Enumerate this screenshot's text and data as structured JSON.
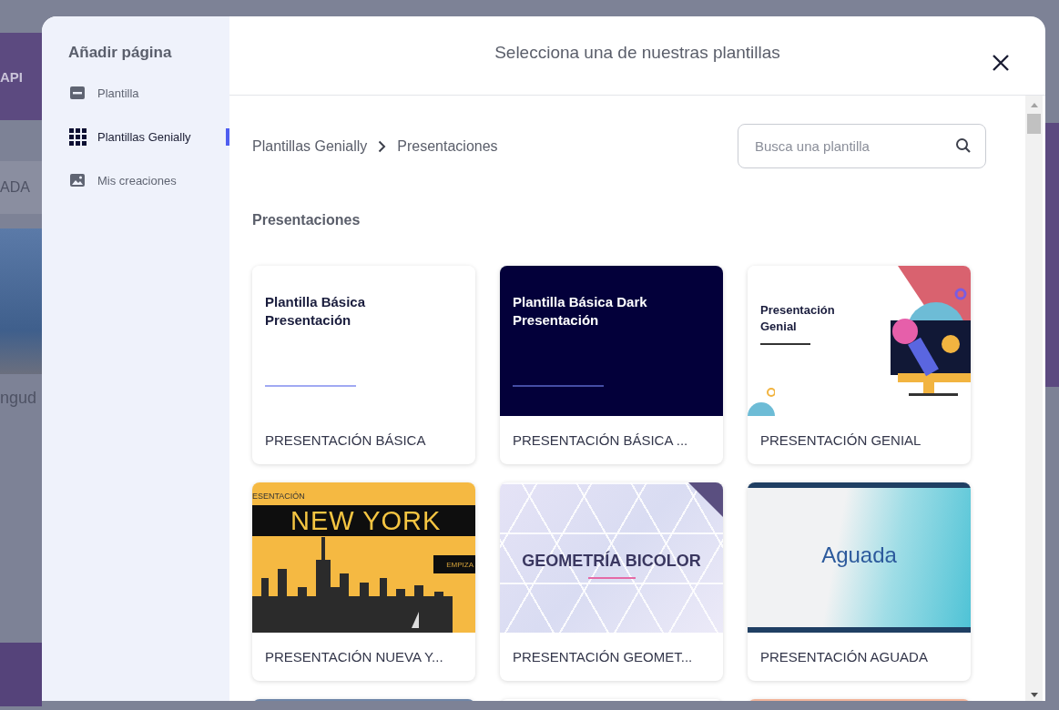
{
  "background": {
    "texts": [
      "API",
      "ADA",
      "ngud"
    ]
  },
  "sidebar": {
    "title": "Añadir página",
    "items": [
      {
        "label": "Plantilla",
        "kind": "card",
        "selected": false
      },
      {
        "label": "Plantillas Genially",
        "kind": "grid",
        "selected": true
      },
      {
        "label": "Mis creaciones",
        "kind": "image",
        "selected": false
      }
    ]
  },
  "header": {
    "title": "Selecciona una de nuestras plantillas"
  },
  "breadcrumb": [
    "Plantillas Genially",
    "Presentaciones"
  ],
  "search": {
    "placeholder": "Busca una plantilla"
  },
  "section_title": "Presentaciones",
  "templates": [
    {
      "kind": "basic-light",
      "name": "PRESENTACIÓN BÁSICA",
      "preview": [
        "Plantilla Básica",
        "Presentación"
      ]
    },
    {
      "kind": "basic-dark",
      "name": "PRESENTACIÓN BÁSICA ...",
      "preview": [
        "Plantilla Básica Dark",
        "Presentación"
      ]
    },
    {
      "kind": "genial",
      "name": "PRESENTACIÓN GENIAL",
      "preview": [
        "Presentación",
        "Genial"
      ]
    },
    {
      "kind": "newyork",
      "name": "PRESENTACIÓN NUEVA Y...",
      "preview": [
        "ESENTACIÓN",
        "NEW YORK",
        "EMPIZA"
      ]
    },
    {
      "kind": "geometry",
      "name": "PRESENTACIÓN GEOMET...",
      "preview": [
        "GEOMETRÍA BICOLOR"
      ]
    },
    {
      "kind": "aguada",
      "name": "PRESENTACIÓN AGUADA",
      "preview": [
        "Aguada"
      ]
    }
  ],
  "more_cards": [
    {
      "color": "#6f86a8"
    },
    {
      "color": "#ffffff"
    },
    {
      "color": "#f2b49a"
    }
  ]
}
